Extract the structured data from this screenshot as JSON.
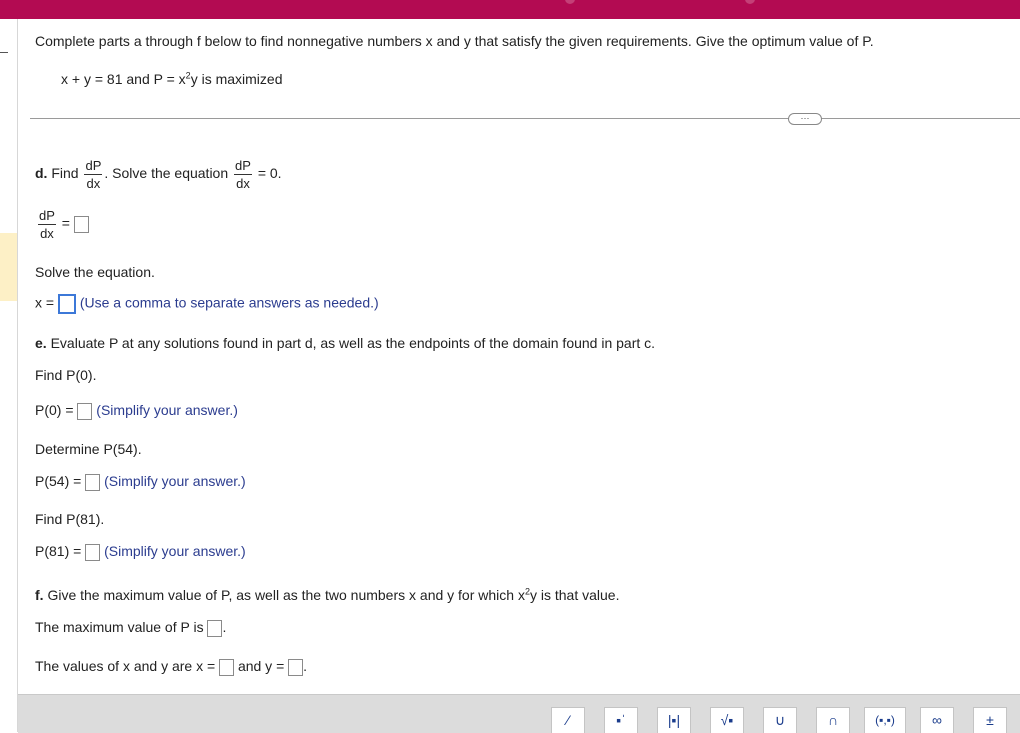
{
  "instructions": "Complete parts a through f below to find nonnegative numbers x and y that satisfy the given requirements. Give the optimum value of P.",
  "problem": {
    "pre": "x + y = 81 and P = x",
    "exp": "2",
    "post": "y is maximized"
  },
  "part_d": {
    "bold": "d.",
    "find": "Find",
    "between": ". Solve the equation",
    "equals_zero": "= 0.",
    "num": "dP",
    "den": "dx",
    "answer_eq": "=",
    "solve_text": "Solve the equation.",
    "x_label": "x =",
    "x_hint": "(Use a comma to separate answers as needed.)"
  },
  "part_e": {
    "bold": "e.",
    "text": "Evaluate P at any solutions found in part d, as well as the endpoints of the domain found in part c.",
    "find_p0": "Find P(0).",
    "p0_label": "P(0) =",
    "determine_p54": "Determine P(54).",
    "p54_label": "P(54) =",
    "find_p81": "Find P(81).",
    "p81_label": "P(81) =",
    "simplify": "(Simplify your answer.)"
  },
  "part_f": {
    "bold": "f.",
    "text_pre": "Give the maximum value of P, as well as the two numbers x and y for which x",
    "exp": "2",
    "text_post": "y is that value.",
    "max_label": "The maximum value of P is",
    "period": ".",
    "values_label": "The values of x and y are x =",
    "and_y": "and y =",
    "period2": "."
  },
  "ellipsis": "···",
  "toolbar": [
    {
      "name": "fraction-tool",
      "glyph": "⁄"
    },
    {
      "name": "exponent-tool",
      "glyph": "▪ˈ"
    },
    {
      "name": "absolute-value-tool",
      "glyph": "|▪|"
    },
    {
      "name": "square-root-tool",
      "glyph": "√▪"
    },
    {
      "name": "union-tool",
      "glyph": "∪"
    },
    {
      "name": "intersection-tool",
      "glyph": "∩"
    },
    {
      "name": "interval-tool",
      "glyph": "(▪,▪)"
    },
    {
      "name": "infinity-tool",
      "glyph": "∞"
    },
    {
      "name": "plus-minus-tool",
      "glyph": "±"
    }
  ]
}
